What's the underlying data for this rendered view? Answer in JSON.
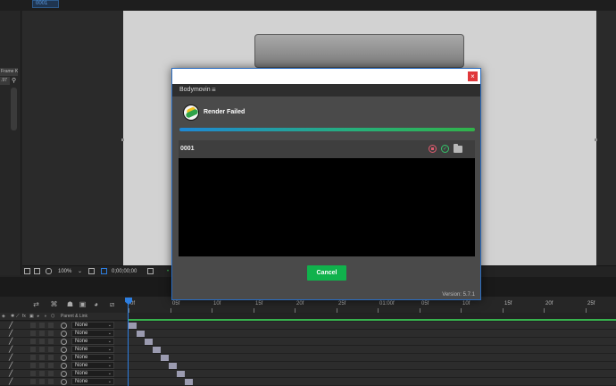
{
  "comp_tab": "0001",
  "left_panel": {
    "item_a": "Frame K...",
    "item_b": ".97"
  },
  "viewer_toolbar": {
    "zoom": "100%",
    "timecode": "0;00;00;00"
  },
  "timeline": {
    "ruler": [
      "0f",
      "05f",
      "10f",
      "15f",
      "20f",
      "25f",
      "01:00f",
      "05f",
      "10f",
      "15f",
      "20f",
      "25f"
    ],
    "columns_header": {
      "parent_link": "Parent & Link"
    },
    "layers": [
      {
        "parent": "None"
      },
      {
        "parent": "None"
      },
      {
        "parent": "None"
      },
      {
        "parent": "None"
      },
      {
        "parent": "None"
      },
      {
        "parent": "None"
      },
      {
        "parent": "None"
      },
      {
        "parent": "None"
      }
    ]
  },
  "modal": {
    "close_glyph": "×",
    "panel_title": "Bodymovin",
    "menu_glyph": "≡",
    "status": "Render Failed",
    "progress": 1.0,
    "render_item": {
      "name": "0001",
      "check_glyph": "✓"
    },
    "cancel_label": "Cancel",
    "version": "Version: 5.7.1"
  },
  "colors": {
    "accent_blue": "#2d7ee0",
    "success_green": "#10b24c",
    "error_red": "#e0383b"
  },
  "icons": {
    "modal_close": "close-icon",
    "panel_menu": "hamburger-menu-icon",
    "render_stop": "stop-circle-icon",
    "render_done": "check-circle-icon",
    "render_folder": "folder-icon",
    "layer_pencil": "pencil-icon",
    "layer_parent_pickwhip": "pickwhip-spiral-icon"
  }
}
